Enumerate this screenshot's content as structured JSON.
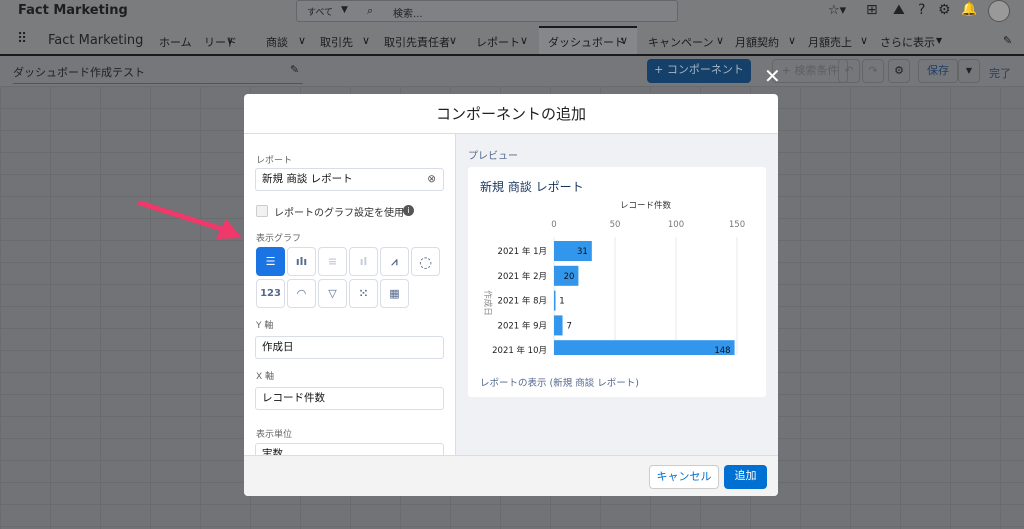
{
  "app": {
    "title": "Fact Marketing",
    "search_scope": "すべて",
    "search_placeholder": "検索..."
  },
  "nav": {
    "app_name": "Fact Marketing",
    "items": [
      {
        "label": "ホーム",
        "dropdown": false
      },
      {
        "label": "リード",
        "dropdown": true
      },
      {
        "label": "商談",
        "dropdown": true
      },
      {
        "label": "取引先",
        "dropdown": true
      },
      {
        "label": "取引先責任者",
        "dropdown": true
      },
      {
        "label": "レポート",
        "dropdown": true
      },
      {
        "label": "ダッシュボード",
        "dropdown": true,
        "active": true
      },
      {
        "label": "キャンペーン",
        "dropdown": true
      },
      {
        "label": "月額契約",
        "dropdown": true
      },
      {
        "label": "月額売上",
        "dropdown": true
      },
      {
        "label": "さらに表示",
        "dropdown": true
      }
    ]
  },
  "dashboard": {
    "name": "ダッシュボード作成テスト",
    "add_component": "+ コンポーネント",
    "filter": "+ 検索条件",
    "save": "保存",
    "done": "完了"
  },
  "modal": {
    "title": "コンポーネントの追加",
    "report_label": "レポート",
    "report_value": "新規 商談 レポート",
    "use_report_chart": "レポートのグラフ設定を使用",
    "use_report_chart_checked": false,
    "chart_type_label": "表示グラフ",
    "chart_types": [
      "horizontal-bar",
      "vertical-bar",
      "stacked-horizontal-bar",
      "stacked-vertical-bar",
      "line",
      "donut",
      "123",
      "gauge",
      "funnel",
      "scatter",
      "table"
    ],
    "y_axis_label": "Y 軸",
    "y_axis_value": "作成日",
    "x_axis_label": "X 軸",
    "x_axis_value": "レコード件数",
    "unit_label": "表示単位",
    "unit_value": "実数",
    "preview_label": "プレビュー",
    "preview_title": "新規 商談 レポート",
    "view_report_link": "レポートの表示 (新規 商談 レポート)",
    "cancel": "キャンセル",
    "add": "追加"
  },
  "colors": {
    "accent": "#0070d2",
    "bar": "#3296ed",
    "arrow": "#f0386b"
  },
  "chart_data": {
    "type": "bar",
    "orientation": "horizontal",
    "xlabel": "レコード件数",
    "ylabel": "作成日",
    "categories": [
      "2021 年 1月",
      "2021 年 2月",
      "2021 年 8月",
      "2021 年 9月",
      "2021 年 10月"
    ],
    "values": [
      31,
      20,
      1,
      7,
      148
    ],
    "xlim": [
      0,
      150
    ],
    "ticks": [
      "0",
      "50",
      "100",
      "150"
    ]
  }
}
